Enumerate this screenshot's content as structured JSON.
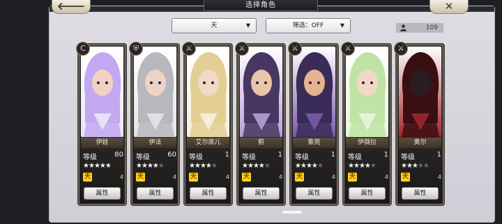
{
  "header": {
    "title": "选择角色",
    "back_label": "🡐",
    "close_label": "✕"
  },
  "filters": {
    "element_value": "天",
    "filter_value": "筛选：OFF",
    "count": "109"
  },
  "labels": {
    "level": "等级",
    "attribute_button": "属性",
    "element_glyph": "天"
  },
  "characters": [
    {
      "name": "伊娃",
      "level": "80",
      "stars": 5,
      "max_stars": 5,
      "element_count": "4",
      "class_icon": "c-icon",
      "art": [
        "#c2a8f0",
        "#e9e4f7",
        "#f2d2c4"
      ]
    },
    {
      "name": "伊法",
      "level": "60",
      "stars": 4,
      "max_stars": 5,
      "element_count": "4",
      "class_icon": "armor-icon",
      "art": [
        "#b7b7be",
        "#e4e4e8",
        "#efd2c6"
      ]
    },
    {
      "name": "艾尔席儿",
      "level": "1",
      "stars": 4,
      "max_stars": 5,
      "element_count": "4",
      "class_icon": "sword-icon",
      "art": [
        "#e3cf93",
        "#f5efe0",
        "#f1d8c7"
      ]
    },
    {
      "name": "蓟",
      "level": "1",
      "stars": 4,
      "max_stars": 5,
      "element_count": "4",
      "class_icon": "sword-icon",
      "art": [
        "#473762",
        "#b89fd7",
        "#e8c6a8"
      ]
    },
    {
      "name": "紫苑",
      "level": "1",
      "stars": 4,
      "max_stars": 5,
      "element_count": "4",
      "class_icon": "sword-icon",
      "art": [
        "#3a2b58",
        "#7a5aa8",
        "#e3b48f"
      ]
    },
    {
      "name": "伊薇拉",
      "level": "1",
      "stars": 4,
      "max_stars": 5,
      "element_count": "4",
      "class_icon": "sword-icon",
      "art": [
        "#bfe3a6",
        "#e8f3df",
        "#f3d7c6"
      ]
    },
    {
      "name": "奥尔",
      "level": "1",
      "stars": 3,
      "max_stars": 5,
      "element_count": "4",
      "class_icon": "sword-icon",
      "art": [
        "#3a0f12",
        "#a1262c",
        "#2a1d22"
      ]
    }
  ],
  "colors": {
    "accent": "#ffd21a",
    "card_frame": "#4a4540"
  }
}
